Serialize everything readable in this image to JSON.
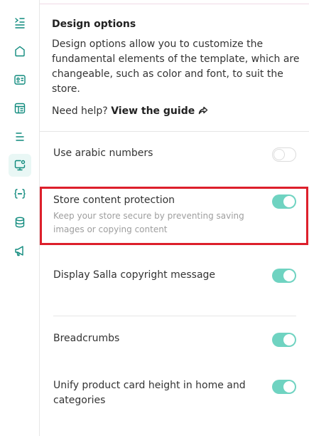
{
  "sidebar": {
    "items": [
      {
        "icon": "collapse-menu-icon"
      },
      {
        "icon": "home-icon"
      },
      {
        "icon": "id-card-icon"
      },
      {
        "icon": "template-icon"
      },
      {
        "icon": "menu-lines-icon"
      },
      {
        "icon": "design-options-icon",
        "active": true
      },
      {
        "icon": "code-braces-icon"
      },
      {
        "icon": "database-icon"
      },
      {
        "icon": "megaphone-icon"
      }
    ],
    "accent": "#0f8a7d"
  },
  "intro": {
    "title": "Design options",
    "description": "Design options allow you to customize the fundamental elements of the template, which are changeable, such as color and font, to suit the store.",
    "help_text": "Need help?",
    "guide_link": "View the guide"
  },
  "options": [
    {
      "label": "Use arabic numbers",
      "enabled": false
    },
    {
      "label": "Store content protection",
      "sub": "Keep your store secure by preventing saving images or copying content",
      "enabled": true
    },
    {
      "label": "Display Salla copyright message",
      "enabled": true
    },
    {
      "label": "Breadcrumbs",
      "enabled": true
    },
    {
      "label": "Unify product card height in home and categories",
      "enabled": true
    }
  ],
  "colors": {
    "toggle_on": "#6fd3c1",
    "highlight": "#dd1f2b"
  }
}
